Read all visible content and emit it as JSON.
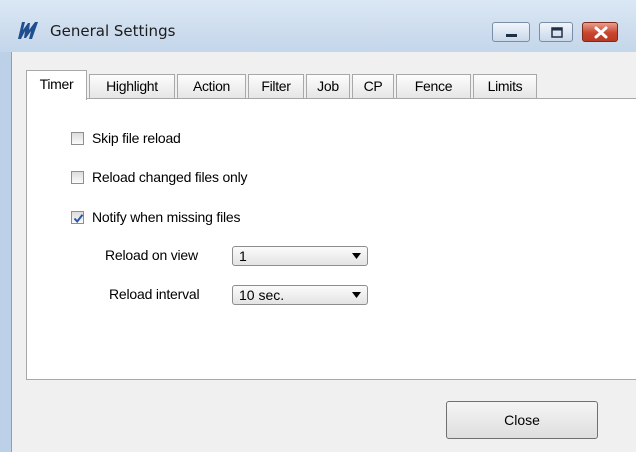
{
  "window": {
    "title": "General Settings",
    "icon": "app-logo-icon",
    "controls": [
      "minimize-icon",
      "maximize-icon",
      "close-icon"
    ]
  },
  "tabs": [
    {
      "label": "Timer",
      "active": true
    },
    {
      "label": "Highlight",
      "active": false
    },
    {
      "label": "Action",
      "active": false
    },
    {
      "label": "Filter",
      "active": false
    },
    {
      "label": "Job",
      "active": false
    },
    {
      "label": "CP",
      "active": false
    },
    {
      "label": "Fence",
      "active": false
    },
    {
      "label": "Limits",
      "active": false
    }
  ],
  "options": {
    "skip_reload": {
      "label": "Skip file reload",
      "checked": false
    },
    "reload_changed": {
      "label": "Reload changed files only",
      "checked": false
    },
    "notify_missing": {
      "label": "Notify when missing files",
      "checked": true
    }
  },
  "reload_on_view": {
    "label": "Reload on view",
    "value": "1"
  },
  "reload_interval": {
    "label": "Reload interval",
    "value": "10 sec."
  },
  "buttons": {
    "close": "Close"
  },
  "colors": {
    "frame": "#bcd1e8",
    "caption_close": "#c8452e",
    "check_mark": "#2b55a8"
  }
}
